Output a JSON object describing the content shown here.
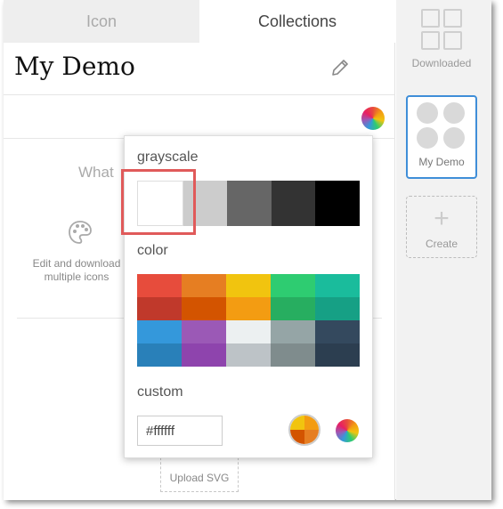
{
  "tabs": [
    {
      "label": "Icon"
    },
    {
      "label": "Collections"
    }
  ],
  "collection_title": "My Demo",
  "empty_state": {
    "heading": "What",
    "caption": "Edit and download multiple icons"
  },
  "upload_label": "Upload SVG",
  "sidebar": {
    "items": [
      {
        "label": "Downloaded"
      },
      {
        "label": "My Demo"
      },
      {
        "label": "Create"
      }
    ]
  },
  "color_popup": {
    "grayscale_heading": "grayscale",
    "color_heading": "color",
    "custom_heading": "custom",
    "custom_value": "#ffffff",
    "grayscale": [
      "#ffffff",
      "#cccccc",
      "#666666",
      "#333333",
      "#000000"
    ],
    "colors": [
      [
        "#e74c3c",
        "#e67e22",
        "#f1c40f",
        "#2ecc71",
        "#1abc9c"
      ],
      [
        "#c0392b",
        "#d35400",
        "#f39c12",
        "#27ae60",
        "#16a085"
      ],
      [
        "#3498db",
        "#9b59b6",
        "#ecf0f1",
        "#95a5a6",
        "#34495e"
      ],
      [
        "#2980b9",
        "#8e44ad",
        "#bdc3c7",
        "#7f8c8d",
        "#2c3e50"
      ]
    ]
  },
  "icons": [
    "pencil-icon",
    "color-wheel-icon",
    "palette-icon",
    "plus-icon"
  ]
}
